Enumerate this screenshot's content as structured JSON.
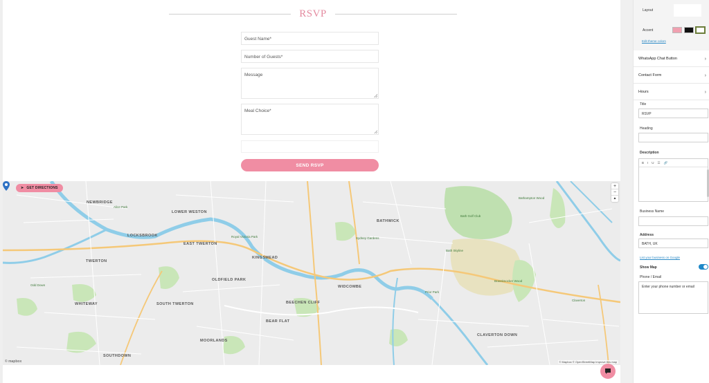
{
  "form": {
    "title": "RSVP",
    "guest_name": "Guest Name*",
    "num_guests": "Number of Guests*",
    "message": "Message",
    "meal_choice": "Meal Choice*",
    "send_label": "SEND RSVP"
  },
  "map": {
    "directions_label": "GET DIRECTIONS",
    "zoom_in": "+",
    "zoom_out": "−",
    "compass": "▲",
    "attribution": "© Mapbox © OpenStreetMap Improve this map",
    "logo": "© mapbox",
    "districts": [
      "NEWBRIDGE",
      "LOWER WESTON",
      "LOCKSBROOK",
      "EAST TWERTON",
      "TWERTON",
      "KINGSMEAD",
      "BATHWICK",
      "OLDFIELD PARK",
      "WHITEWAY",
      "SOUTH TWERTON",
      "WIDCOMBE",
      "BEECHEN CLIFF",
      "BEAR FLAT",
      "MOORLANDS",
      "SOUTHDOWN",
      "CLAVERTON DOWN"
    ],
    "places": [
      "Bath Golf Club",
      "Bathampton Wood",
      "Brassknocker Wood",
      "Royal Victoria Park",
      "Alice Park",
      "Bath Skyline",
      "Sydney Gardens",
      "Prior Park",
      "Odd Down",
      "Claverton"
    ]
  },
  "panel": {
    "layout_label": "Layout",
    "accent_label": "Accent",
    "accent_colors": [
      "#f0a0b0",
      "#111111",
      "#ffffff"
    ],
    "edit_theme": "Edit theme colors",
    "sections": [
      "WhatsApp Chat Button",
      "Contact Form",
      "Hours"
    ],
    "title_label": "Title",
    "title_value": "RSVP",
    "heading_label": "Heading",
    "description_label": "Description",
    "rte_tools": [
      "B",
      "I",
      "U",
      "☰",
      "🔗"
    ],
    "business_name_label": "Business Name",
    "address_label": "Address",
    "address_value": "BATH, UK",
    "google_link": "List your business on Google",
    "show_map_label": "Show Map",
    "phone_label": "Phone / Email",
    "phone_placeholder": "Enter your phone number or email"
  }
}
